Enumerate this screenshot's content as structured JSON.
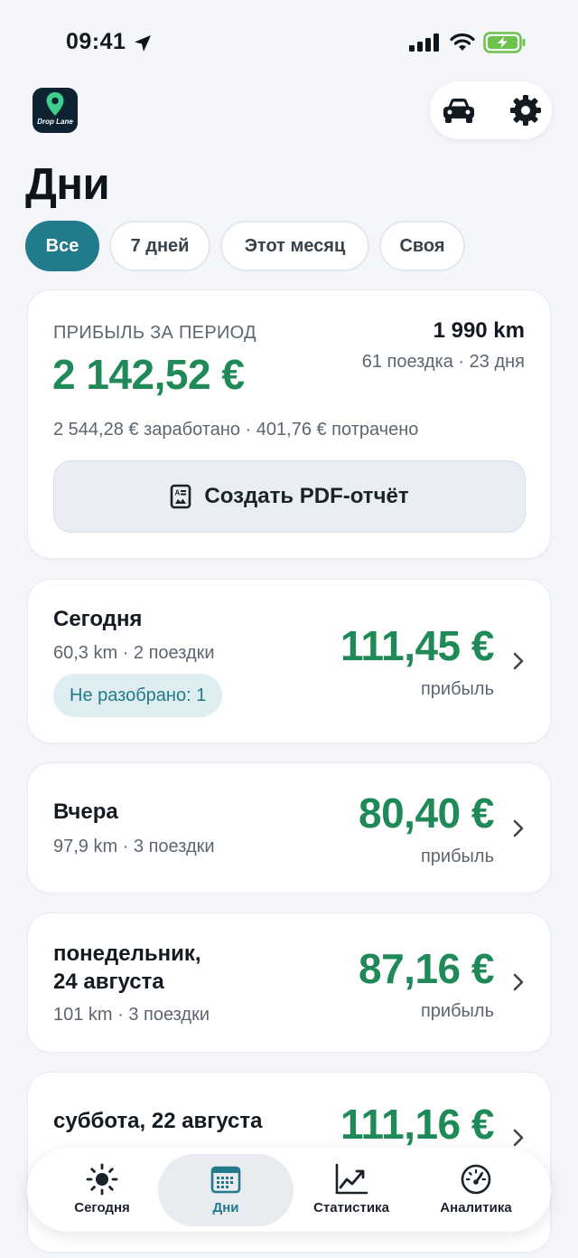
{
  "status_bar": {
    "time": "09:41"
  },
  "header": {
    "app_logo_text": "Drop Lane",
    "title": "Дни"
  },
  "filters": [
    {
      "label": "Все",
      "active": true
    },
    {
      "label": "7 дней",
      "active": false
    },
    {
      "label": "Этот месяц",
      "active": false
    },
    {
      "label": "Своя",
      "active": false
    }
  ],
  "summary": {
    "label": "ПРИБЫЛЬ ЗА ПЕРИОД",
    "profit": "2 142,52 €",
    "distance": "1 990 km",
    "rides": "61 поездка · 23 дня",
    "breakdown": "2 544,28 € заработано · 401,76 € потрачено",
    "pdf_button": "Создать PDF-отчёт"
  },
  "days": [
    {
      "title": "Сегодня",
      "meta": "60,3 km · 2 поездки",
      "amount": "111,45 €",
      "sub": "прибыль",
      "badge": "Не разобрано: 1"
    },
    {
      "title": "Вчера",
      "meta": "97,9 km · 3 поездки",
      "amount": "80,40 €",
      "sub": "прибыль"
    },
    {
      "title_line1": "понедельник,",
      "title_line2": "24 августа",
      "meta": "101 km · 3 поездки",
      "amount": "87,16 €",
      "sub": "прибыль"
    },
    {
      "title": "суббота, 22 августа",
      "amount": "111,16 €"
    }
  ],
  "tabs": [
    {
      "label": "Сегодня",
      "icon": "sun-icon",
      "active": false
    },
    {
      "label": "Дни",
      "icon": "calendar-icon",
      "active": true
    },
    {
      "label": "Статистика",
      "icon": "chart-icon",
      "active": false
    },
    {
      "label": "Аналитика",
      "icon": "gauge-icon",
      "active": false
    }
  ],
  "colors": {
    "accent": "#217b8c",
    "profit_green": "#1f8a57",
    "background": "#f4f6fa"
  }
}
